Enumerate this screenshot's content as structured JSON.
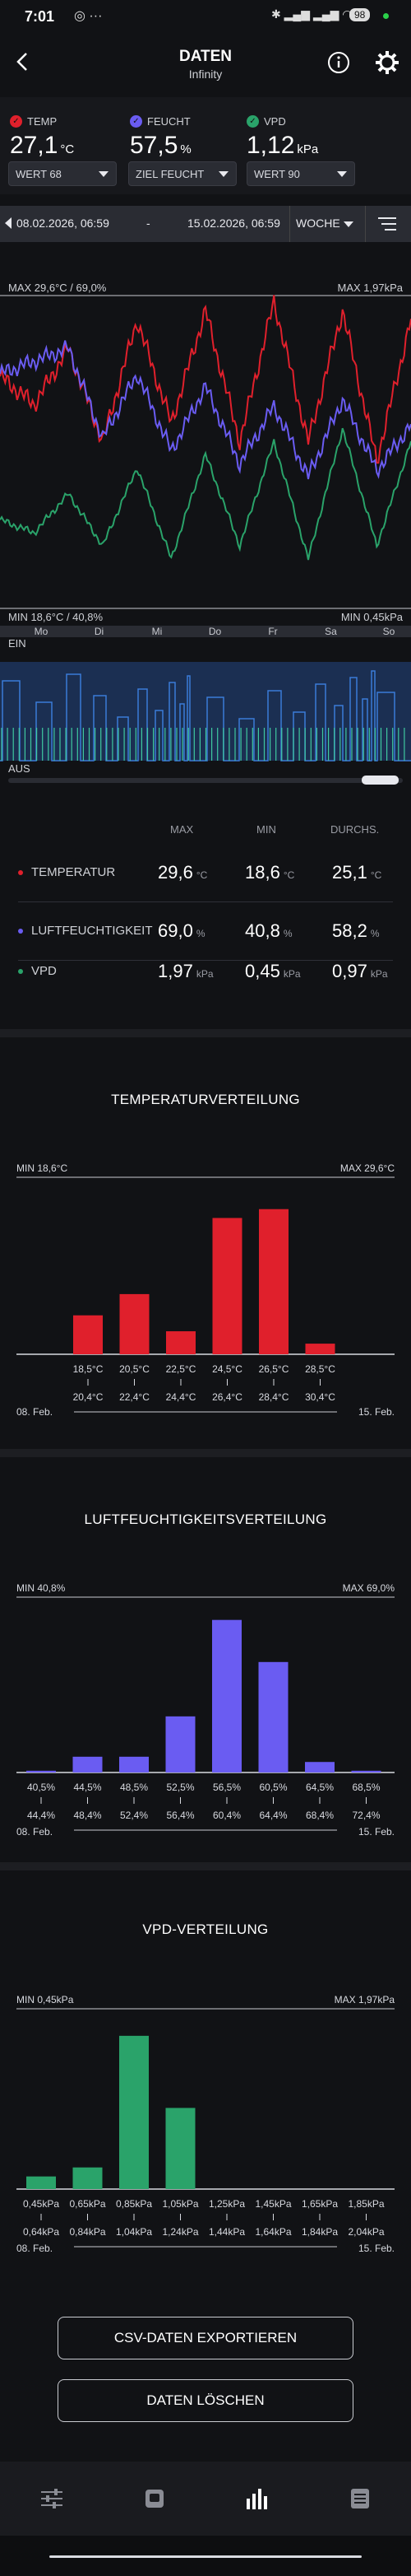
{
  "status_bar": {
    "time": "7:01",
    "battery": "98"
  },
  "header": {
    "title": "DATEN",
    "subtitle": "Infinity"
  },
  "readings": [
    {
      "label": "TEMP",
      "value": "27,1",
      "unit": "°C",
      "color": "#e0202c",
      "select": "WERT 68"
    },
    {
      "label": "FEUCHT",
      "value": "57,5",
      "unit": "%",
      "color": "#6a5cf2",
      "select": "ZIEL FEUCHT"
    },
    {
      "label": "VPD",
      "value": "1,12",
      "unit": "kPa",
      "color": "#2aa36a",
      "select": "WERT 90"
    }
  ],
  "date_range": {
    "start": "08.02.2026, 06:59",
    "separator": "-",
    "end": "15.02.2026, 06:59",
    "period": "WOCHE"
  },
  "line_chart": {
    "max_left": "MAX 29,6°C / 69,0%",
    "max_right": "MAX 1,97kPa",
    "min_left": "MIN 18,6°C / 40,8%",
    "min_right": "MIN 0,45kPa",
    "days": [
      "Mo",
      "Di",
      "Mi",
      "Do",
      "Fr",
      "Sa",
      "So"
    ],
    "on_label": "EIN",
    "off_label": "AUS",
    "colors": {
      "temp": "#e0202c",
      "humidity": "#6a5cf2",
      "vpd": "#2aa36a",
      "device": "#3b7bd8"
    }
  },
  "chart_data": [
    {
      "type": "line",
      "title": "",
      "x": [
        "Mo",
        "Di",
        "Mi",
        "Do",
        "Fr",
        "Sa",
        "So"
      ],
      "series": [
        {
          "values_temp_c": [
            25.5,
            24,
            27,
            22,
            28.5,
            23,
            29,
            22,
            29.5,
            22,
            29,
            21,
            28.5
          ]
        },
        {
          "values_humidity_pct": [
            60,
            62,
            64,
            50,
            60,
            48,
            58,
            46,
            55,
            44,
            56,
            45,
            52
          ]
        },
        {
          "values_vpd_kpa": [
            1.1,
            1.0,
            1.3,
            0.9,
            1.5,
            0.8,
            1.6,
            0.9,
            1.7,
            0.8,
            1.8,
            0.9,
            1.7
          ]
        }
      ],
      "ylim_left": [
        18.6,
        29.6
      ],
      "ylim_right": [
        0.45,
        1.97
      ]
    },
    {
      "type": "bar",
      "title": "TEMPERATURVERTEILUNG",
      "min_label": "MIN 18,6°C",
      "max_label": "MAX 29,6°C",
      "categories_top": [
        "18,5°C",
        "20,5°C",
        "22,5°C",
        "24,5°C",
        "26,5°C",
        "28,5°C"
      ],
      "categories_bottom": [
        "20,4°C",
        "22,4°C",
        "24,4°C",
        "26,4°C",
        "28,4°C",
        "30,4°C"
      ],
      "values": [
        22,
        34,
        13,
        77,
        82,
        6
      ],
      "color": "#e0202c",
      "start": "08. Feb.",
      "end": "15. Feb."
    },
    {
      "type": "bar",
      "title": "LUFTFEUCHTIGKEITSVERTEILUNG",
      "min_label": "MIN 40,8%",
      "max_label": "MAX 69,0%",
      "categories_top": [
        "40,5%",
        "44,5%",
        "48,5%",
        "52,5%",
        "56,5%",
        "60,5%",
        "64,5%",
        "68,5%"
      ],
      "categories_bottom": [
        "44,4%",
        "48,4%",
        "52,4%",
        "56,4%",
        "60,4%",
        "64,4%",
        "68,4%",
        "72,4%"
      ],
      "values": [
        1,
        9,
        9,
        32,
        87,
        63,
        6,
        1
      ],
      "color": "#6a5cf2",
      "start": "08. Feb.",
      "end": "15. Feb."
    },
    {
      "type": "bar",
      "title": "VPD-VERTEILUNG",
      "min_label": "MIN 0,45kPa",
      "max_label": "MAX 1,97kPa",
      "categories_top": [
        "0,45kPa",
        "0,65kPa",
        "0,85kPa",
        "1,05kPa",
        "1,25kPa",
        "1,45kPa",
        "1,65kPa",
        "1,85kPa"
      ],
      "categories_bottom": [
        "0,64kPa",
        "0,84kPa",
        "1,04kPa",
        "1,24kPa",
        "1,44kPa",
        "1,64kPa",
        "1,84kPa",
        "2,04kPa"
      ],
      "values": [
        7,
        12,
        85,
        45,
        0,
        0,
        0,
        0
      ],
      "color": "#2aa36a",
      "start": "08. Feb.",
      "end": "15. Feb."
    }
  ],
  "stats": {
    "headers": [
      "MAX",
      "MIN",
      "DURCHS."
    ],
    "rows": [
      {
        "name": "TEMPERATUR",
        "color": "#e0202c",
        "max": "29,6",
        "min": "18,6",
        "avg": "25,1",
        "unit": "°C"
      },
      {
        "name": "LUFTFEUCHTIGKEIT",
        "color": "#6a5cf2",
        "max": "69,0",
        "min": "40,8",
        "avg": "58,2",
        "unit": "%"
      },
      {
        "name": "VPD",
        "color": "#2aa36a",
        "max": "1,97",
        "min": "0,45",
        "avg": "0,97",
        "unit": "kPa"
      }
    ]
  },
  "buttons": {
    "export": "CSV-DATEN EXPORTIEREN",
    "delete": "DATEN LÖSCHEN"
  },
  "nav": [
    "sliders-icon",
    "device-icon",
    "bar-chart-icon",
    "list-icon"
  ]
}
